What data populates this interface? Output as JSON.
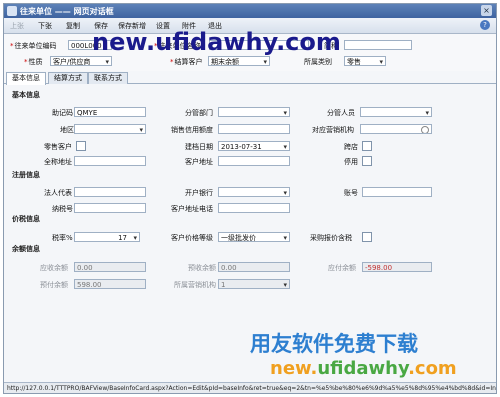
{
  "window": {
    "title": "往来单位 —— 网页对话框",
    "close_glyph": "×"
  },
  "toolbar": {
    "items": [
      "上张",
      "下张",
      "复制",
      "保存",
      "保存新增",
      "设置",
      "附件",
      "退出"
    ],
    "help": "?"
  },
  "header": {
    "code_label": "往来单位编码",
    "code_value": "000L000",
    "name_label": "往来单位名称",
    "name_value": "",
    "abbr_label": "简称",
    "abbr_value": "",
    "nature_label": "性质",
    "nature_value": "客户/供应商",
    "settle_label": "结算客户",
    "settle_value": "期末余额",
    "category_label": "所属类别",
    "category_value": "零售"
  },
  "tabs": [
    "基本信息",
    "结算方式",
    "联系方式"
  ],
  "basic": {
    "section": "基本信息",
    "mnemonic_label": "助记码",
    "mnemonic_value": "QMYE",
    "dept_label": "分管部门",
    "dept_value": "",
    "staff_label": "分管人员",
    "staff_value": "",
    "region_label": "地区",
    "region_value": "",
    "credit_label": "销售信用额度",
    "credit_value": "",
    "org_label": "对应营销机构",
    "org_value": "",
    "retail_label": "零售客户",
    "date_label": "建档日期",
    "date_value": "2013-07-31",
    "cross_label": "跨店",
    "full_addr_label": "全称地址",
    "full_addr_value": "",
    "cust_addr_label": "客户地址",
    "cust_addr_value": "",
    "disabled_label": "停用"
  },
  "register": {
    "section": "注册信息",
    "legal_label": "法人代表",
    "legal_value": "",
    "bank_label": "开户银行",
    "bank_value": "",
    "account_label": "账号",
    "account_value": "",
    "tax_label": "纳税号",
    "tax_value": "",
    "addr_phone_label": "客户地址电话",
    "addr_phone_value": ""
  },
  "price": {
    "section": "价税信息",
    "rate_label": "税率%",
    "rate_value": "17",
    "level_label": "客户价格等级",
    "level_value": "一级批发价",
    "purchase_tax_label": "采购报价含税"
  },
  "balance": {
    "section": "余额信息",
    "ar_label": "应收余额",
    "ar_value": "0.00",
    "prepay_recv_label": "预收余额",
    "prepay_recv_value": "0.00",
    "ap_label": "应付余额",
    "ap_value": "-598.00",
    "prepay_pay_label": "预付余额",
    "prepay_pay_value": "598.00",
    "org2_label": "所属营销机构",
    "org2_value": "1"
  },
  "statusbar": {
    "text": "http://127.0.0.1/TTTPRO/BAFView/BaseInfoCard.aspx?Action=Edit&pId=baseInfo&ret=true&eq=2&tn=%e5%be%80%e6%9d%a5%e5%8d%95%e4%bd%8d&id=Intr"
  },
  "watermarks": {
    "top": "new.ufidawhy.com",
    "cn": "用友软件免费下载",
    "bottom_a": "new.",
    "bottom_b": "ufidawhy",
    "bottom_c": ".com"
  }
}
